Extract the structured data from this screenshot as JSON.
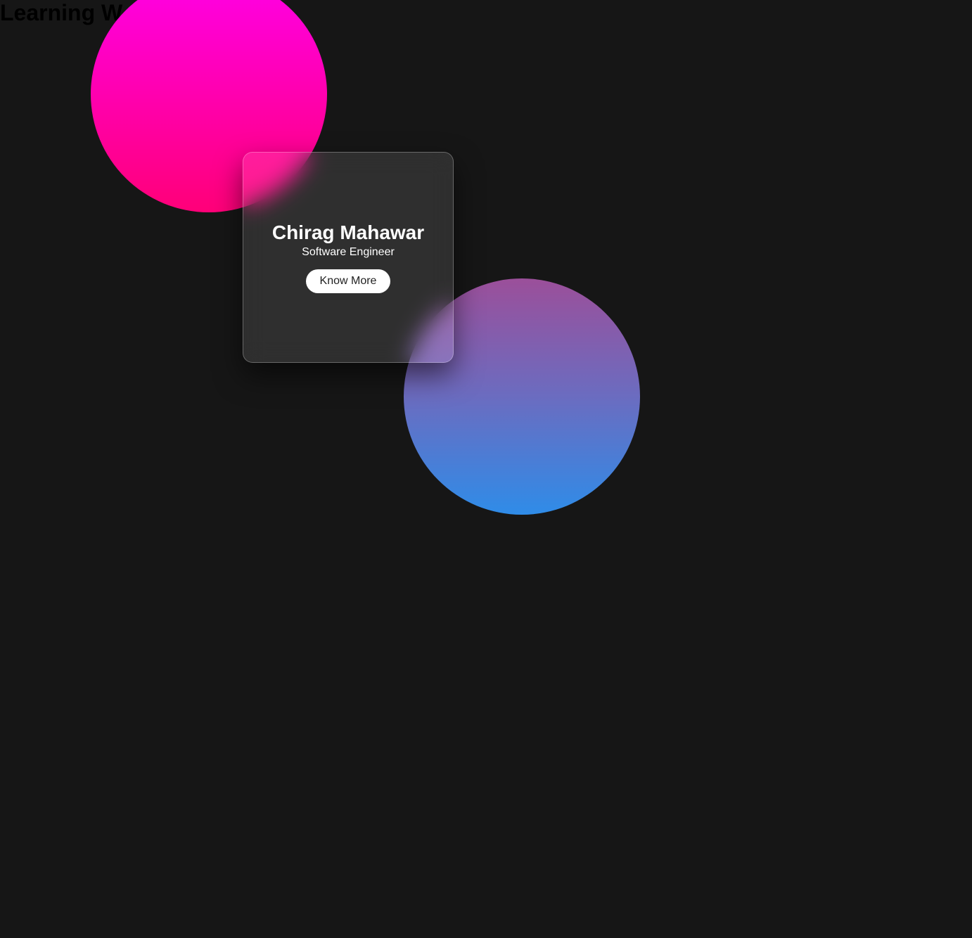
{
  "page": {
    "heading": "Learning W",
    "background_color": "#161616"
  },
  "decor": {
    "pink_circle_gradient": [
      "#ff00e6",
      "#ff0078"
    ],
    "blue_circle_gradient": [
      "#9b4f9a",
      "#6b6cc0",
      "#2f8ce8"
    ]
  },
  "card": {
    "name": "Chirag Mahawar",
    "role": "Software Engineer",
    "button_label": "Know More"
  }
}
